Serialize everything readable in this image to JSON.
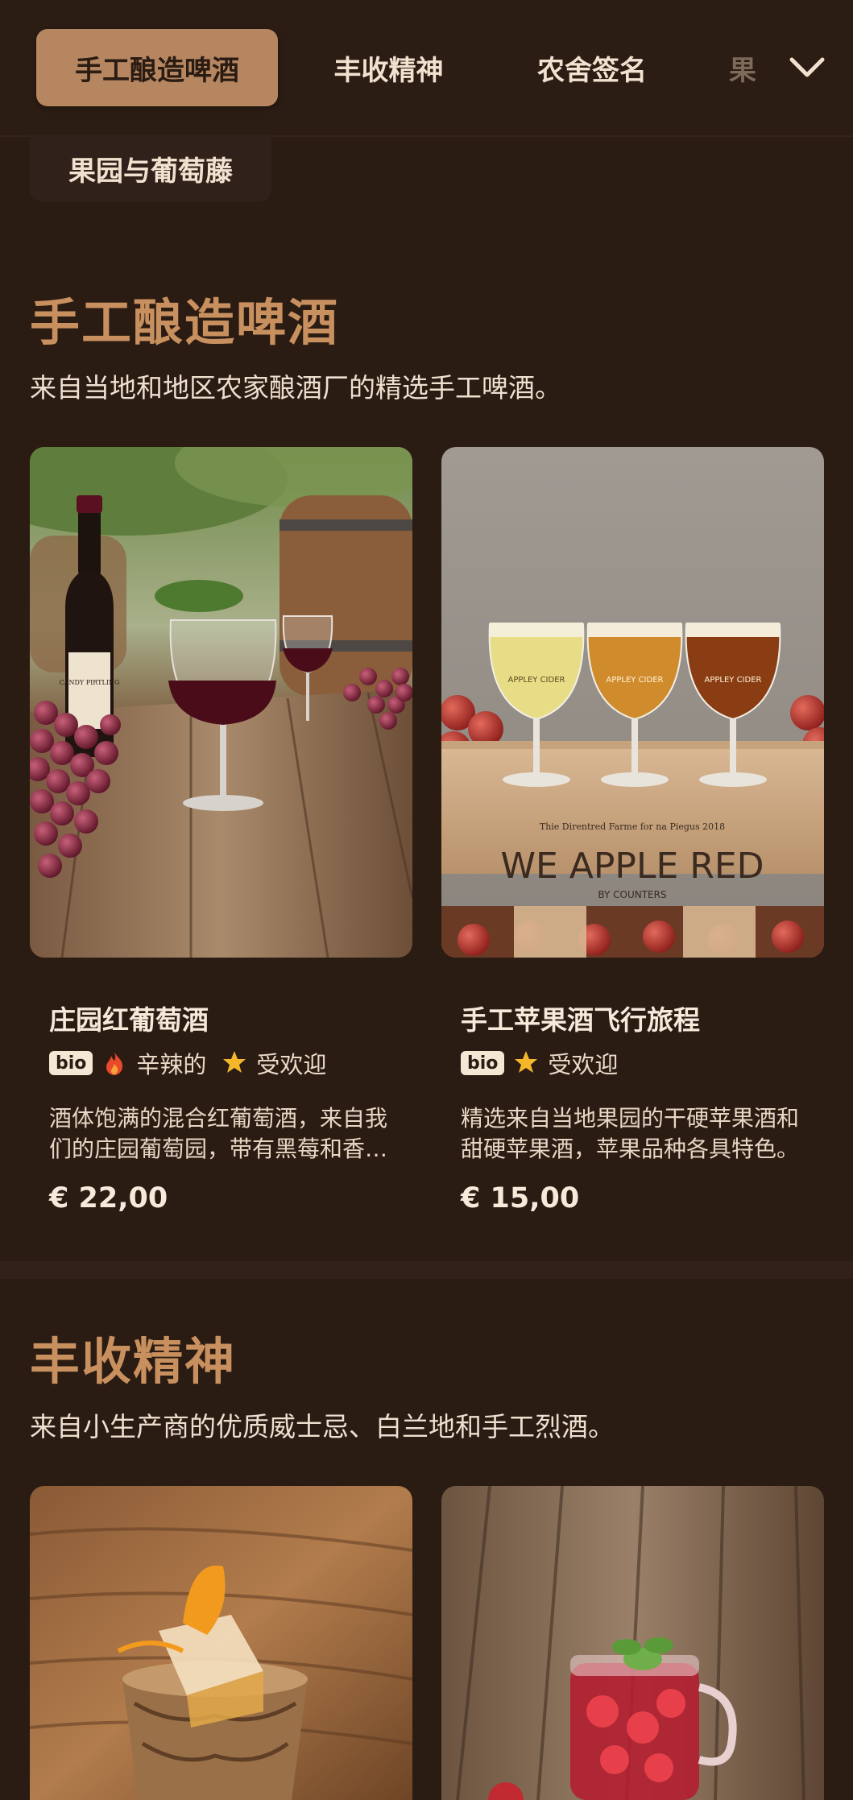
{
  "nav": {
    "tabs": [
      {
        "label": "手工酿造啤酒",
        "active": true
      },
      {
        "label": "丰收精神",
        "active": false
      },
      {
        "label": "农舍签名",
        "active": false
      },
      {
        "label": "果",
        "active": false
      }
    ],
    "overflow_chip": "果园与葡萄藤",
    "expand_icon": "chevron-down-icon"
  },
  "sections": [
    {
      "title": "手工酿造啤酒",
      "description": "来自当地和地区农家酿酒厂的精选手工啤酒。",
      "items": [
        {
          "name": "庄园红葡萄酒",
          "tags": {
            "bio": "bio",
            "spicy": "辛辣的",
            "popular": "受欢迎"
          },
          "description": "酒体饱满的混合红葡萄酒，来自我们的庄园葡萄园，带有黑莓和香料的味道。",
          "price": "€ 22,00",
          "image": {
            "bottle_label": "CANDY PIRTLING"
          }
        },
        {
          "name": "手工苹果酒飞行旅程",
          "tags": {
            "bio": "bio",
            "popular": "受欢迎"
          },
          "description": "精选来自当地果园的干硬苹果酒和甜硬苹果酒，苹果品种各具特色。",
          "price": "€ 15,00",
          "image": {
            "glass_labels": [
              "APPLEY CIDER",
              "APPLEY CIDER",
              "APPLEY CIDER"
            ],
            "crate_top": "Thie Direntred Farme for na Piegus 2018",
            "crate_main": "WE APPLE RED",
            "crate_sub": "BY COUNTERS"
          }
        }
      ]
    },
    {
      "title": "丰收精神",
      "description": "来自小生产商的优质威士忌、白兰地和手工烈酒。"
    }
  ],
  "colors": {
    "background": "#2a1b13",
    "accent": "#b68660",
    "section_title": "#c8905f"
  }
}
